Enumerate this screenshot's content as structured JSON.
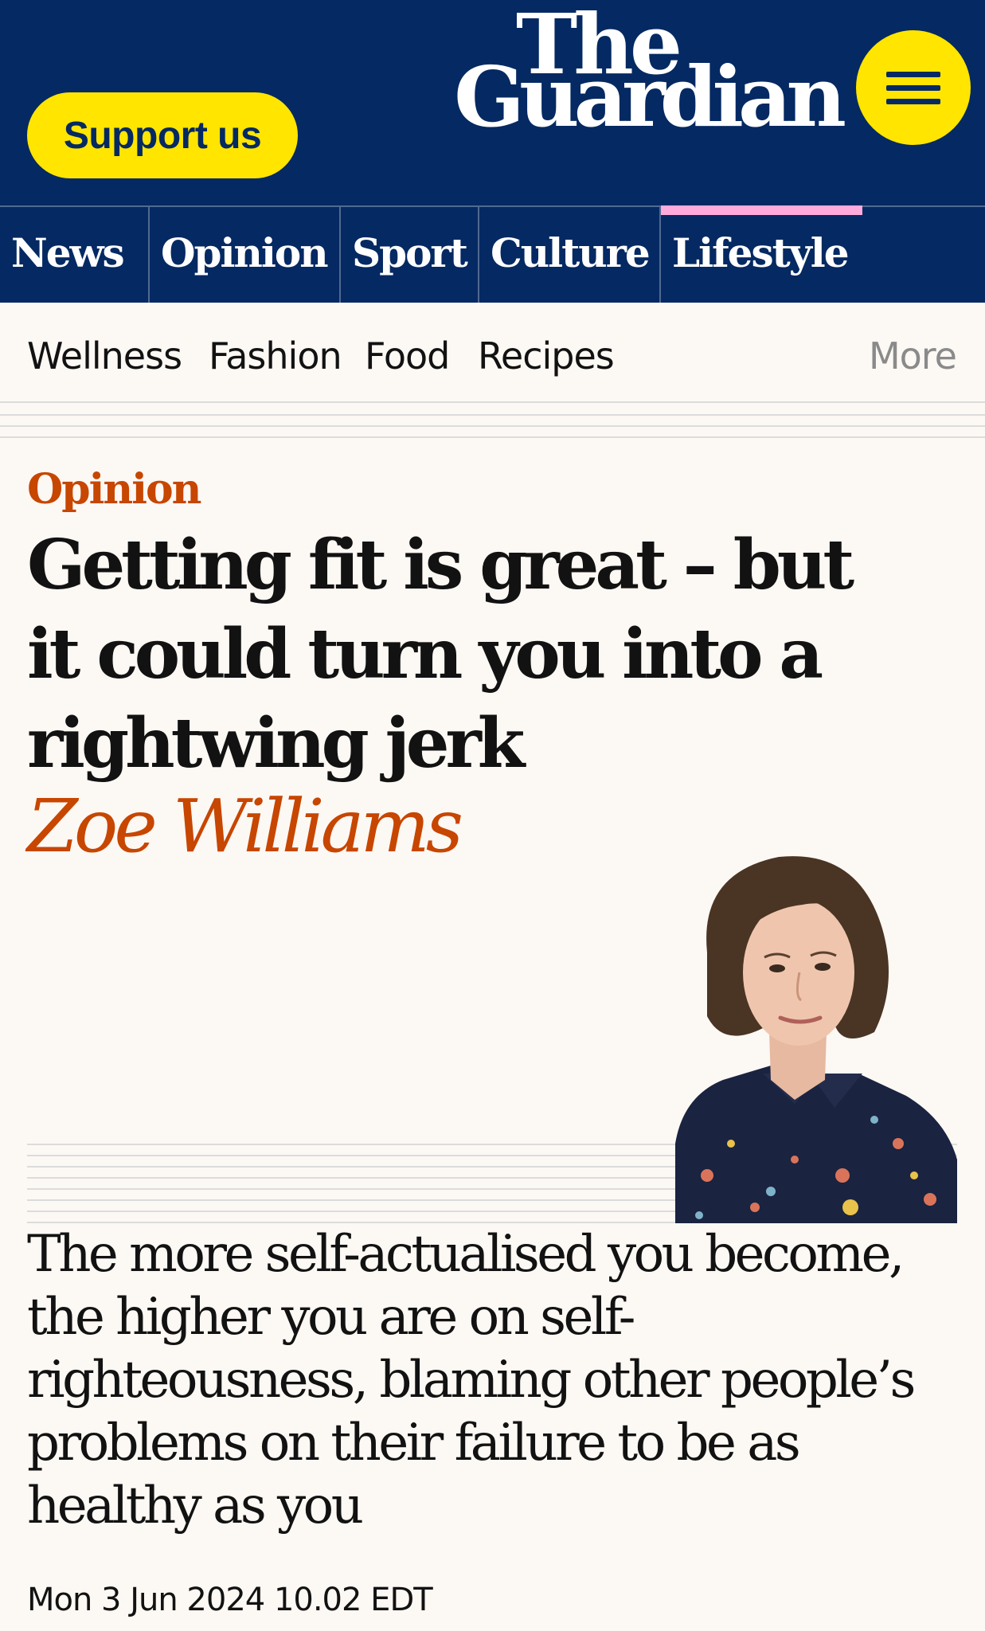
{
  "header": {
    "support_label": "Support us",
    "logo_line1": "The",
    "logo_line2": "Guardian",
    "menu_icon": "hamburger-menu-icon"
  },
  "pillars": [
    {
      "label": "News"
    },
    {
      "label": "Opinion"
    },
    {
      "label": "Sport"
    },
    {
      "label": "Culture"
    },
    {
      "label": "Lifestyle",
      "active": true
    }
  ],
  "subnav": {
    "items": [
      "Wellness",
      "Fashion",
      "Food",
      "Recipes"
    ],
    "more_label": "More"
  },
  "article": {
    "kicker": "Opinion",
    "headline": "Getting fit is great – but it could turn you into a rightwing jerk",
    "byline": "Zoe Williams",
    "standfirst": "The more self-actualised you become, the higher you are on self-righteousness, blaming other people’s problems on their failure to be as healthy as you",
    "dateline": "Mon 3 Jun 2024 10.02 EDT"
  },
  "colors": {
    "brand_blue": "#052962",
    "support_yellow": "#ffe500",
    "opinion_orange": "#c74600",
    "lifestyle_pink": "#ffabdb",
    "page_background": "#fcf8f4"
  }
}
